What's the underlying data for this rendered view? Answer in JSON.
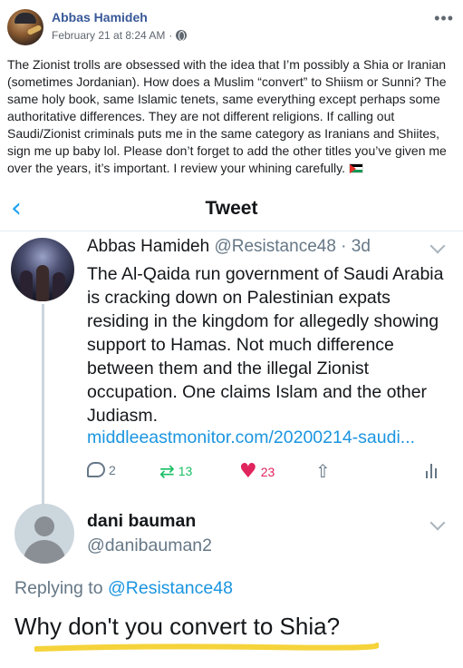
{
  "post": {
    "author": "Abbas Hamideh",
    "timestamp": "February 21 at 8:24 AM",
    "meta_separator": "·",
    "more_icon": "more-options-icon",
    "text": "The Zionist trolls are obsessed with the idea that I’m possibly a Shia or Iranian (sometimes Jordanian). How does a Muslim “convert” to Shiism or Sunni? The same holy book, same Islamic tenets, same everything except perhaps some authoritative differences. They are not different religions. If calling out Saudi/Zionist criminals puts me in the same category as Iranians and Shiites, sign me up baby lol. Please don’t forget to add the other titles you’ve given me over the years, it’s important. I review your whining carefully. "
  },
  "tweet_view": {
    "title": "Tweet",
    "original": {
      "name": "Abbas Hamideh",
      "handle": "@Resistance48 · 3d",
      "text": "The Al-Qaida run government of Saudi Arabia is cracking down on Palestinian expats residing in the kingdom for allegedly showing support to Hamas. Not much difference between them and the illegal Zionist occupation. One claims Islam and the other Judiasm.",
      "link": "middleeastmonitor.com/20200214-saudi...",
      "replies": "2",
      "retweets": "13",
      "likes": "23"
    },
    "reply": {
      "name": "dani bauman",
      "handle": "@danibauman2",
      "replying_prefix": "Replying to ",
      "replying_to": "@Resistance48",
      "text": "Why don't you convert to Shia?"
    }
  },
  "colors": {
    "facebook_link": "#385898",
    "twitter_blue": "#1da1f2",
    "like_red": "#e0245e",
    "retweet_green": "#17bf63",
    "highlight_yellow": "#f5d33a"
  }
}
